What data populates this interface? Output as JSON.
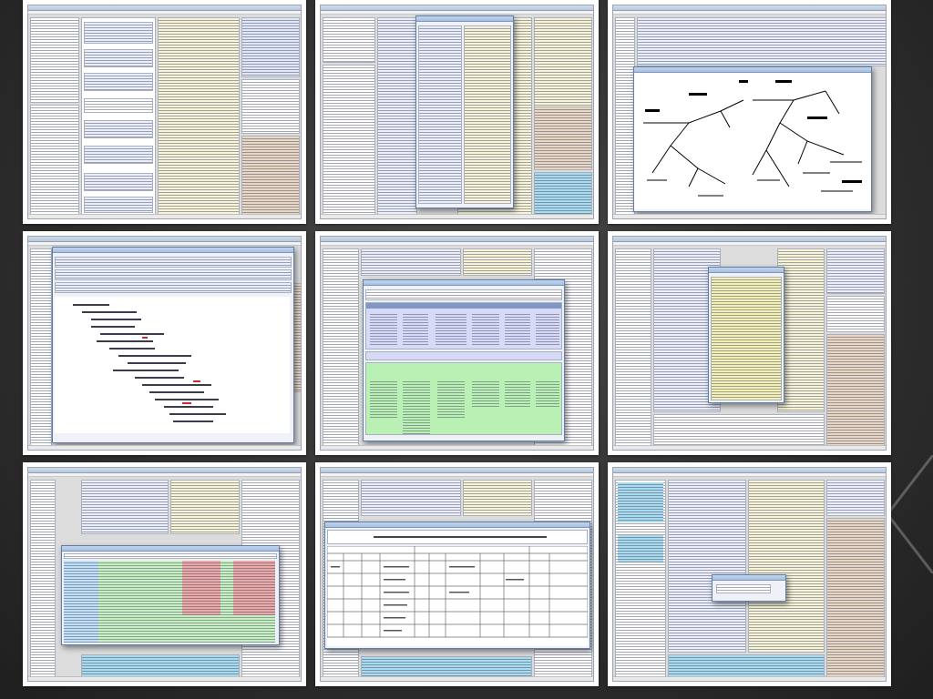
{
  "page": {
    "background": "#2e2e2e"
  },
  "colors": {
    "window_title_bar": "#b9c9dc",
    "panel_cream": "#f6f3d6",
    "panel_blue": "#dfe6f6",
    "panel_tan": "#e8d7c3",
    "panel_cyan": "#a9dbef",
    "panel_green": "#b9f0b4",
    "panel_pink": "#e9a9a6",
    "panel_lavender": "#d6daf7"
  },
  "thumbnails": [
    {
      "id": "list-view"
    },
    {
      "id": "popup-editor"
    },
    {
      "id": "tree-diagram"
    },
    {
      "id": "code-window"
    },
    {
      "id": "green-grid-dialog"
    },
    {
      "id": "floating-notes"
    },
    {
      "id": "colored-table-dialog"
    },
    {
      "id": "data-table-dialog"
    },
    {
      "id": "small-prompt"
    }
  ]
}
